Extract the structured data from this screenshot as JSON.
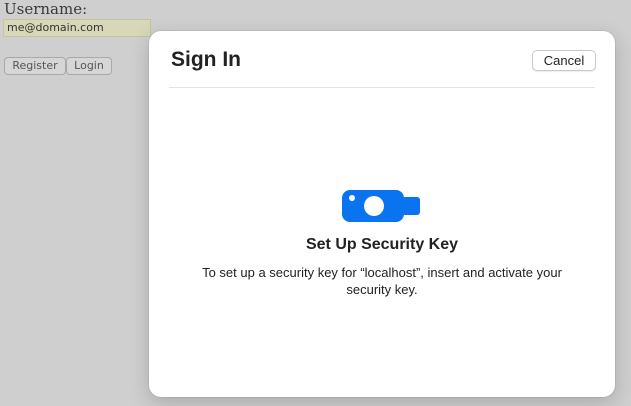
{
  "background_form": {
    "username_label": "Username:",
    "username_value": "me@domain.com",
    "register_label": "Register",
    "login_label": "Login"
  },
  "dialog": {
    "title": "Sign In",
    "cancel_label": "Cancel",
    "icon": "security-key-icon",
    "heading": "Set Up Security Key",
    "description": "To set up a security key for “localhost”, insert and activate your security key."
  },
  "colors": {
    "accent": "#0a74f0",
    "backdrop": "#cfcfcf",
    "dialog_bg": "#ffffff"
  }
}
